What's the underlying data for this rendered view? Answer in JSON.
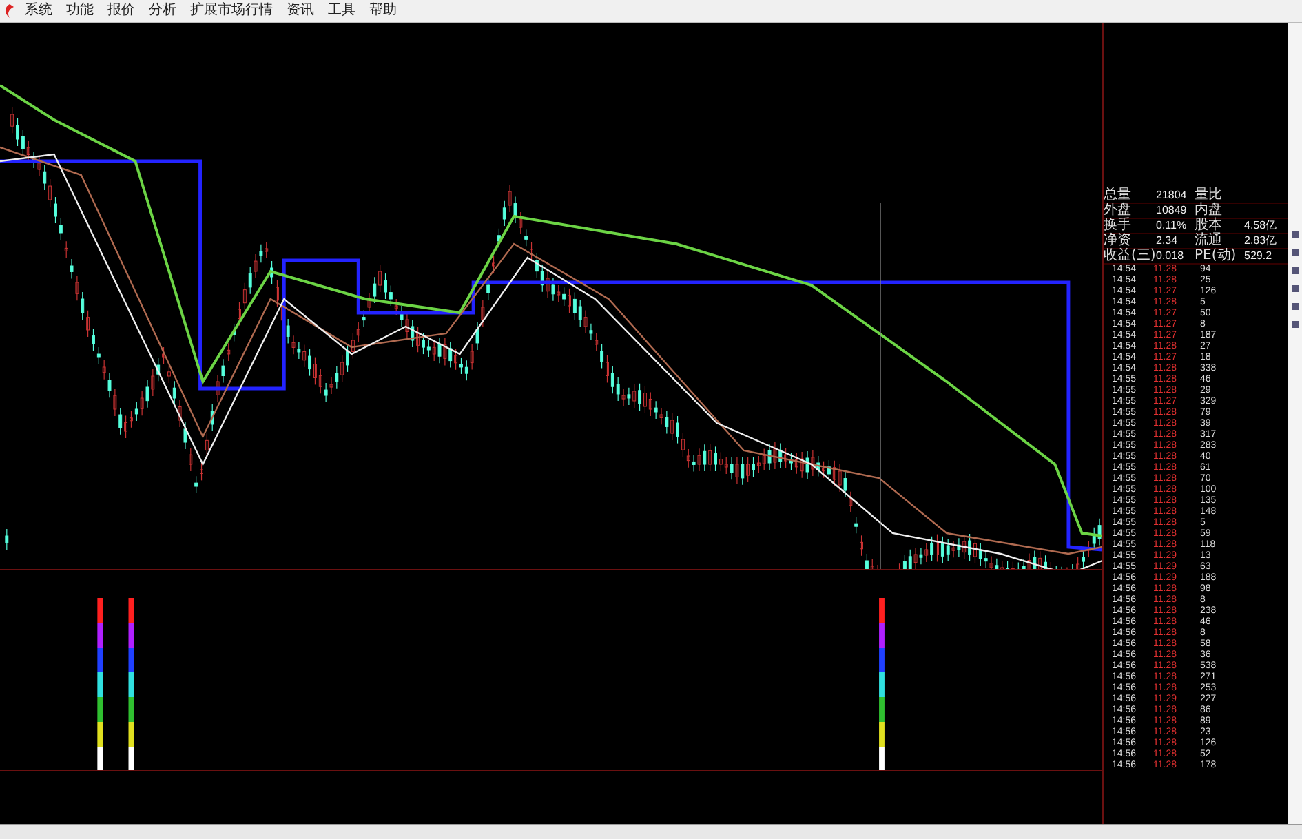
{
  "menu": [
    {
      "label": "系统"
    },
    {
      "label": "功能"
    },
    {
      "label": "报价"
    },
    {
      "label": "分析"
    },
    {
      "label": "扩展市场行情"
    },
    {
      "label": "资讯"
    },
    {
      "label": "工具"
    },
    {
      "label": "帮助"
    }
  ],
  "quote_summary": [
    {
      "label": "总量",
      "value": "21804",
      "label_2": "量比"
    },
    {
      "label": "外盘",
      "value": "10849",
      "label_2": "内盘"
    },
    {
      "label": "换手",
      "value": "0.11%",
      "label_2": "股本",
      "value_2": "4.58亿"
    },
    {
      "label": "净资",
      "value": "2.34",
      "label_2": "流通",
      "value_2": "2.83亿"
    },
    {
      "label": "收益(三)",
      "value": "0.018",
      "label_2": "PE(动)",
      "value_2": "529.2"
    }
  ],
  "trades": [
    {
      "time": "14:54",
      "price": "11.28",
      "volume": "94"
    },
    {
      "time": "14:54",
      "price": "11.28",
      "volume": "25"
    },
    {
      "time": "14:54",
      "price": "11.27",
      "volume": "126"
    },
    {
      "time": "14:54",
      "price": "11.28",
      "volume": "5"
    },
    {
      "time": "14:54",
      "price": "11.27",
      "volume": "50"
    },
    {
      "time": "14:54",
      "price": "11.27",
      "volume": "8"
    },
    {
      "time": "14:54",
      "price": "11.27",
      "volume": "187"
    },
    {
      "time": "14:54",
      "price": "11.28",
      "volume": "27"
    },
    {
      "time": "14:54",
      "price": "11.27",
      "volume": "18"
    },
    {
      "time": "14:54",
      "price": "11.28",
      "volume": "338"
    },
    {
      "time": "14:55",
      "price": "11.28",
      "volume": "46"
    },
    {
      "time": "14:55",
      "price": "11.28",
      "volume": "29"
    },
    {
      "time": "14:55",
      "price": "11.27",
      "volume": "329"
    },
    {
      "time": "14:55",
      "price": "11.28",
      "volume": "79"
    },
    {
      "time": "14:55",
      "price": "11.28",
      "volume": "39"
    },
    {
      "time": "14:55",
      "price": "11.28",
      "volume": "317"
    },
    {
      "time": "14:55",
      "price": "11.28",
      "volume": "283"
    },
    {
      "time": "14:55",
      "price": "11.28",
      "volume": "40"
    },
    {
      "time": "14:55",
      "price": "11.28",
      "volume": "61"
    },
    {
      "time": "14:55",
      "price": "11.28",
      "volume": "70"
    },
    {
      "time": "14:55",
      "price": "11.28",
      "volume": "100"
    },
    {
      "time": "14:55",
      "price": "11.28",
      "volume": "135"
    },
    {
      "time": "14:55",
      "price": "11.28",
      "volume": "148"
    },
    {
      "time": "14:55",
      "price": "11.28",
      "volume": "5"
    },
    {
      "time": "14:55",
      "price": "11.28",
      "volume": "59"
    },
    {
      "time": "14:55",
      "price": "11.28",
      "volume": "118"
    },
    {
      "time": "14:55",
      "price": "11.29",
      "volume": "13"
    },
    {
      "time": "14:55",
      "price": "11.29",
      "volume": "63"
    },
    {
      "time": "14:56",
      "price": "11.29",
      "volume": "188"
    },
    {
      "time": "14:56",
      "price": "11.28",
      "volume": "98"
    },
    {
      "time": "14:56",
      "price": "11.28",
      "volume": "8"
    },
    {
      "time": "14:56",
      "price": "11.28",
      "volume": "238"
    },
    {
      "time": "14:56",
      "price": "11.28",
      "volume": "46"
    },
    {
      "time": "14:56",
      "price": "11.28",
      "volume": "8"
    },
    {
      "time": "14:56",
      "price": "11.28",
      "volume": "58"
    },
    {
      "time": "14:56",
      "price": "11.28",
      "volume": "36"
    },
    {
      "time": "14:56",
      "price": "11.28",
      "volume": "538"
    },
    {
      "time": "14:56",
      "price": "11.28",
      "volume": "271"
    },
    {
      "time": "14:56",
      "price": "11.28",
      "volume": "253"
    },
    {
      "time": "14:56",
      "price": "11.29",
      "volume": "227"
    },
    {
      "time": "14:56",
      "price": "11.28",
      "volume": "86"
    },
    {
      "time": "14:56",
      "price": "11.28",
      "volume": "89"
    },
    {
      "time": "14:56",
      "price": "11.28",
      "volume": "23"
    },
    {
      "time": "14:56",
      "price": "11.28",
      "volume": "126"
    },
    {
      "time": "14:56",
      "price": "11.28",
      "volume": "52"
    },
    {
      "time": "14:56",
      "price": "11.28",
      "volume": "178"
    }
  ]
}
